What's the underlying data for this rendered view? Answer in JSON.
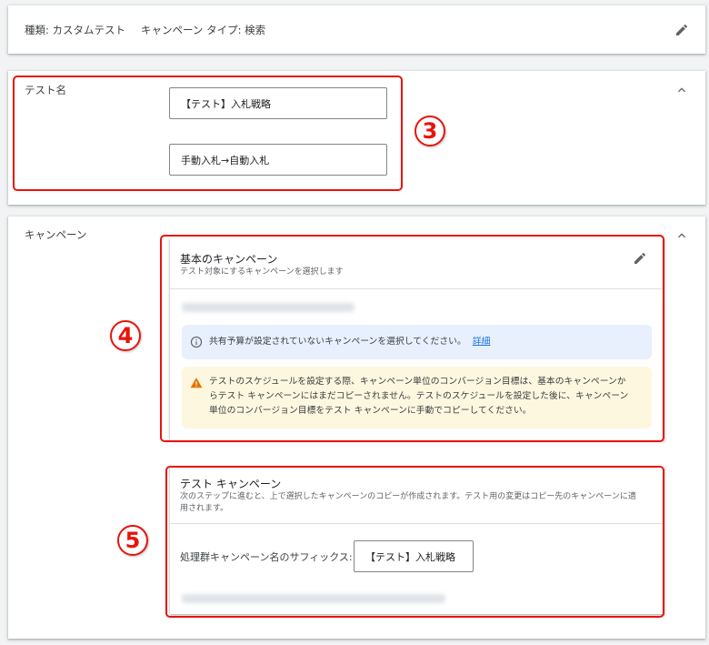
{
  "summary": {
    "type_text": "種類: カスタムテスト",
    "campaign_type_text": "キャンペーン タイプ: 検索"
  },
  "test_name": {
    "label": "テスト名",
    "name_value": "【テスト】入札戦略",
    "description_value": "手動入札→自動入札"
  },
  "campaign": {
    "label": "キャンペーン",
    "base": {
      "title": "基本のキャンペーン",
      "description": "テスト対象にするキャンペーンを選択します",
      "info_text": "共有予算が設定されていないキャンペーンを選択してください。",
      "info_link": "詳細",
      "warning_line1": "テストのスケジュールを設定する際、キャンペーン単位のコンバージョン目標は、基本のキャンペーンか",
      "warning_line2": "らテスト キャンペーンにはまだコピーされません。テストのスケジュールを設定した後に、キャンペーン",
      "warning_line3": "単位のコンバージョン目標をテスト キャンペーンに手動でコピーしてください。"
    },
    "test": {
      "title": "テスト キャンペーン",
      "description_line1": "次のステップに進むと、上で選択したキャンペーンのコピーが作成されます。テスト用の変更はコピー先のキャンペーンに適",
      "description_line2": "用されます。",
      "suffix_label": "処理群キャンペーン名のサフィックス:",
      "suffix_value": "【テスト】入札戦略"
    }
  },
  "annotations": {
    "badge3": "3",
    "badge4": "4",
    "badge5": "5"
  },
  "colors": {
    "annotation_red": "#e8140c",
    "info_bg": "#e8f0fe",
    "warning_bg": "#fef7e0",
    "link_blue": "#1a73e8"
  }
}
